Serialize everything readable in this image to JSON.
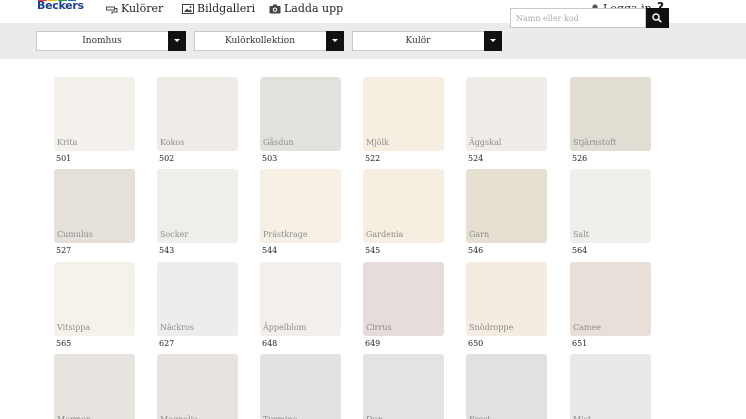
{
  "nav": {
    "brand": "Beckers",
    "colors_label": "Kulörer",
    "gallery_label": "Bildgalleri",
    "upload_label": "Ladda upp",
    "login_label": "Logga in",
    "help_label": "?"
  },
  "filters": {
    "category": "Inomhus",
    "collection": "Kulörkollektion",
    "color": "Kulör",
    "search_placeholder": "Namn eller kod"
  },
  "brand_colors": [
    "#e63b2e",
    "#f5b800",
    "#2a9d4a",
    "#1b6fc4"
  ],
  "swatches": [
    {
      "name": "Krita",
      "code": "501",
      "color": "#f4f1ec"
    },
    {
      "name": "Kokos",
      "code": "502",
      "color": "#efebe6"
    },
    {
      "name": "Gåsdun",
      "code": "503",
      "color": "#e3e1dc"
    },
    {
      "name": "Mjölk",
      "code": "522",
      "color": "#f7eee2"
    },
    {
      "name": "Äggskal",
      "code": "524",
      "color": "#f0ede8"
    },
    {
      "name": "Stjärnstoft",
      "code": "526",
      "color": "#e2ddd3"
    },
    {
      "name": "Cumulus",
      "code": "527",
      "color": "#e5e1da"
    },
    {
      "name": "Socker",
      "code": "543",
      "color": "#eeefeb"
    },
    {
      "name": "Prästkrage",
      "code": "544",
      "color": "#f7f1e5"
    },
    {
      "name": "Gardenia",
      "code": "545",
      "color": "#f6eee0"
    },
    {
      "name": "Garn",
      "code": "546",
      "color": "#e5e0d1"
    },
    {
      "name": "Salt",
      "code": "564",
      "color": "#eff0ec"
    },
    {
      "name": "Vitsippa",
      "code": "565",
      "color": "#f5f2ea"
    },
    {
      "name": "Näckros",
      "code": "627",
      "color": "#efecef"
    },
    {
      "name": "Äppelblom",
      "code": "648",
      "color": "#f3efeb"
    },
    {
      "name": "Cirrus",
      "code": "649",
      "color": "#e5dcdb"
    },
    {
      "name": "Snödroppe",
      "code": "650",
      "color": "#f5ece1"
    },
    {
      "name": "Camee",
      "code": "651",
      "color": "#e8e0d8"
    },
    {
      "name": "Marmor",
      "code": "",
      "color": "#e7e3de"
    },
    {
      "name": "Magnolia",
      "code": "",
      "color": "#e9e3df"
    },
    {
      "name": "Turmine",
      "code": "",
      "color": "#e3e1e2"
    },
    {
      "name": "Dun",
      "code": "",
      "color": "#e4e3e4"
    },
    {
      "name": "Frost",
      "code": "",
      "color": "#e0e1e3"
    },
    {
      "name": "Mist",
      "code": "",
      "color": "#e7e9ea"
    }
  ]
}
